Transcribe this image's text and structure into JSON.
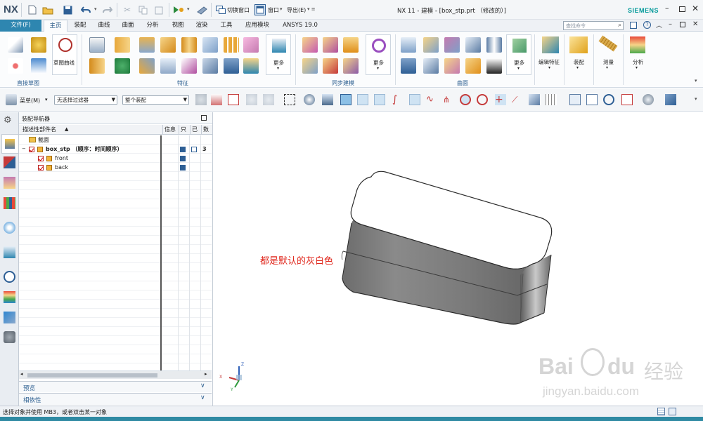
{
  "titlebar": {
    "logo": "NX",
    "switch_window": "切换窗口",
    "window_menu": "窗口",
    "window_chevron": "▾",
    "export_menu": "导出(E)",
    "more_marker": "▾ ≡",
    "title": "NX 11 - 建模 - [box_stp.prt （修改的）]",
    "brand": "SIEMENS",
    "brand_color": "#009999"
  },
  "menubar": {
    "file": "文件(F)",
    "tabs": [
      "主页",
      "装配",
      "曲线",
      "曲面",
      "分析",
      "视图",
      "渲染",
      "工具",
      "应用模块",
      "ANSYS 19.0"
    ],
    "active_tab": "主页",
    "search_placeholder": "查找命令"
  },
  "ribbon": {
    "sketch_label": "草图曲线",
    "groups": [
      "直接草图",
      "特征",
      "同步建模",
      "曲面"
    ],
    "more_label": "更多",
    "edit_feature": "编辑特征",
    "assembly": "装配",
    "measure": "测量",
    "analysis": "分析"
  },
  "selbar": {
    "menu": "菜单(M)",
    "filter": "无选择过滤器",
    "scope": "整个装配"
  },
  "navigator": {
    "title": "装配导航器",
    "columns": [
      "描述性部件名",
      "信息",
      "只",
      "已",
      "数"
    ],
    "rows": [
      {
        "name": "截面",
        "count": ""
      },
      {
        "name": "box_stp （顺序：时间顺序）",
        "count": "3"
      },
      {
        "name": "front",
        "count": ""
      },
      {
        "name": "back",
        "count": ""
      }
    ],
    "preview": "预览",
    "dependency": "相依性"
  },
  "viewport": {
    "annotation": "都是默认的灰白色",
    "annotation_color": "#e0261b",
    "axis_x": "X",
    "axis_y": "Y",
    "axis_z": "Z",
    "watermark_brand": "Bai",
    "watermark_brand2": "du",
    "watermark_cn": "经验",
    "watermark_url": "jingyan.baidu.com"
  },
  "status": {
    "text": "选择对象并使用 MB3，或者双击某一对象"
  }
}
